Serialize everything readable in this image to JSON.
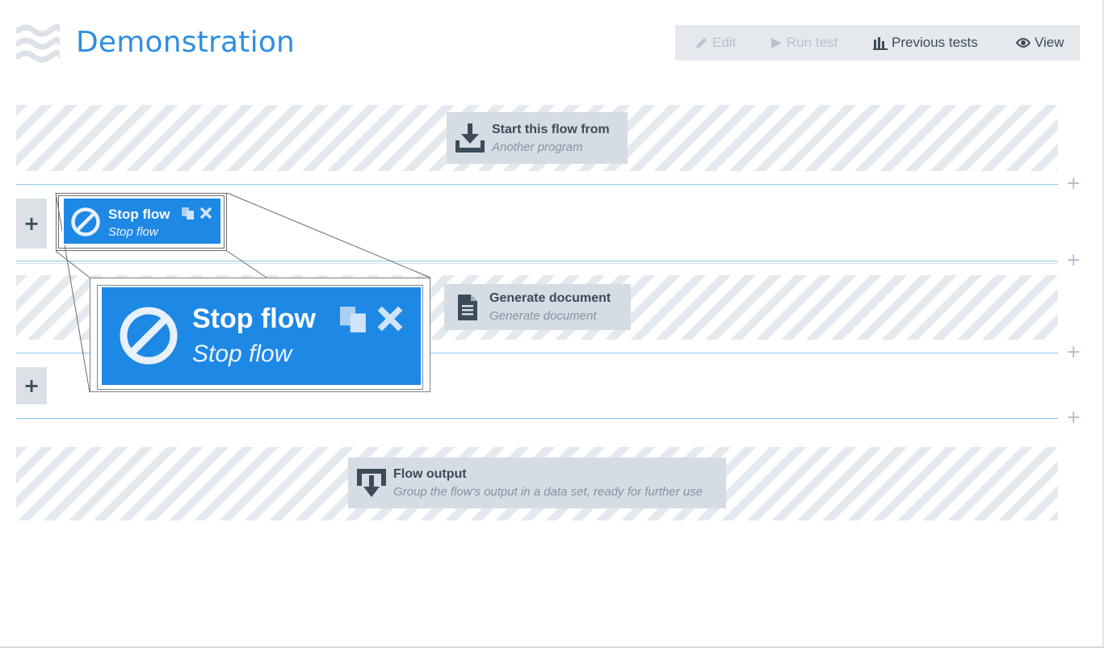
{
  "header": {
    "title": "Demonstration",
    "logo_icon": "waves-icon"
  },
  "toolbar": {
    "edit": {
      "label": "Edit",
      "icon": "pencil-icon",
      "enabled": false
    },
    "run_test": {
      "label": "Run test",
      "icon": "play-icon",
      "enabled": false
    },
    "previous_tests": {
      "label": "Previous tests",
      "icon": "bar-chart-icon",
      "enabled": true
    },
    "view": {
      "label": "View",
      "icon": "eye-icon",
      "enabled": true
    }
  },
  "flow": {
    "start": {
      "title": "Start this flow from",
      "subtitle": "Another program",
      "icon": "download-icon"
    },
    "stop": {
      "title": "Stop flow",
      "subtitle": "Stop flow",
      "icon": "ban-icon",
      "copy_icon": "copy-icon",
      "close_icon": "close-icon"
    },
    "generate": {
      "title": "Generate document",
      "subtitle": "Generate document",
      "icon": "document-icon"
    },
    "output": {
      "title": "Flow output",
      "subtitle": "Group the flow's output in a data set, ready for further use",
      "icon": "flow-output-icon"
    },
    "add_label": "+",
    "insert_label": "+"
  },
  "colors": {
    "accent": "#2f8ee0",
    "node_blue": "#1e88e5",
    "card_gray": "#d5dce3",
    "divider": "#8cc6ea"
  }
}
